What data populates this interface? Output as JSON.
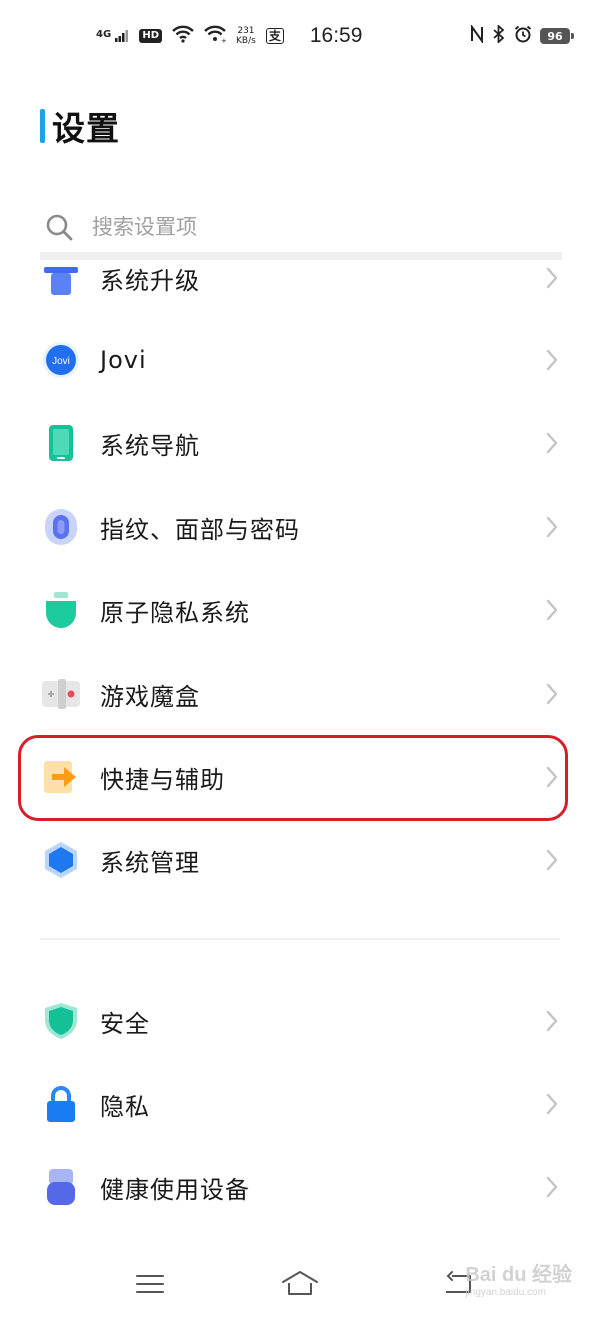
{
  "status_bar": {
    "network": "4G",
    "hd": "HD",
    "net_speed_value": "231",
    "net_speed_unit": "KB/s",
    "alipay_glyph": "支",
    "time": "16:59",
    "battery": "96",
    "icons": [
      "signal-4g-icon",
      "hd-icon",
      "wifi-icon",
      "wifi-icon",
      "alipay-icon",
      "nfc-icon",
      "bluetooth-icon",
      "alarm-icon",
      "battery-icon"
    ]
  },
  "header": {
    "title": "设置"
  },
  "search": {
    "placeholder": "搜索设置项",
    "value": ""
  },
  "items": [
    {
      "label": "系统升级",
      "icon": "system-upgrade-icon"
    },
    {
      "label": "Jovi",
      "icon": "jovi-icon",
      "icon_text": "Jovi"
    },
    {
      "label": "系统导航",
      "icon": "system-navigation-icon"
    },
    {
      "label": "指纹、面部与密码",
      "icon": "fingerprint-icon"
    },
    {
      "label": "原子隐私系统",
      "icon": "atom-privacy-icon"
    },
    {
      "label": "游戏魔盒",
      "icon": "game-box-icon"
    },
    {
      "label": "快捷与辅助",
      "icon": "shortcut-assist-icon",
      "highlighted": true
    },
    {
      "label": "系统管理",
      "icon": "system-management-icon"
    },
    {
      "label": "安全",
      "icon": "security-shield-icon"
    },
    {
      "label": "隐私",
      "icon": "privacy-lock-icon"
    },
    {
      "label": "健康使用设备",
      "icon": "healthy-usage-icon"
    }
  ],
  "colors": {
    "title_accent": "#1aa3e8",
    "highlight_border": "#d81e2a",
    "chevron": "#c4c4c4"
  },
  "watermark": {
    "text": "Bai du 经验",
    "sub": "jingyan.baidu.com"
  }
}
